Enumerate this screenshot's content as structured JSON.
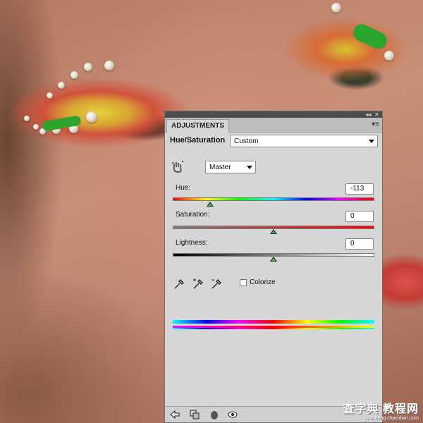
{
  "panel": {
    "tab_title": "ADJUSTMENTS",
    "heading": "Hue/Saturation",
    "preset": "Custom",
    "channel": "Master",
    "hue": {
      "label": "Hue:",
      "value": "-113",
      "level": 0.186
    },
    "saturation": {
      "label": "Saturation:",
      "value": "0",
      "level": 0.5
    },
    "lightness": {
      "label": "Lightness:",
      "value": "0",
      "level": 0.5
    },
    "colorize": {
      "label": "Colorize",
      "checked": false
    }
  },
  "watermark": {
    "main": "查字典 教程网",
    "sub": "jiaocheng.chazidian.com"
  },
  "icons": {
    "hand": "on-image-adjust-hand-icon",
    "eyedropper": "eyedropper-icon",
    "eyedropper_plus": "eyedropper-add-icon",
    "eyedropper_minus": "eyedropper-subtract-icon",
    "back": "back-arrow-icon",
    "clip": "clip-to-layer-icon",
    "reset": "reset-icon",
    "visibility": "eye-icon"
  },
  "colors": {
    "panel_bg": "#d6d6d6",
    "titlebar": "#4c4c4c",
    "thumb_fill": "#4fb84f"
  }
}
